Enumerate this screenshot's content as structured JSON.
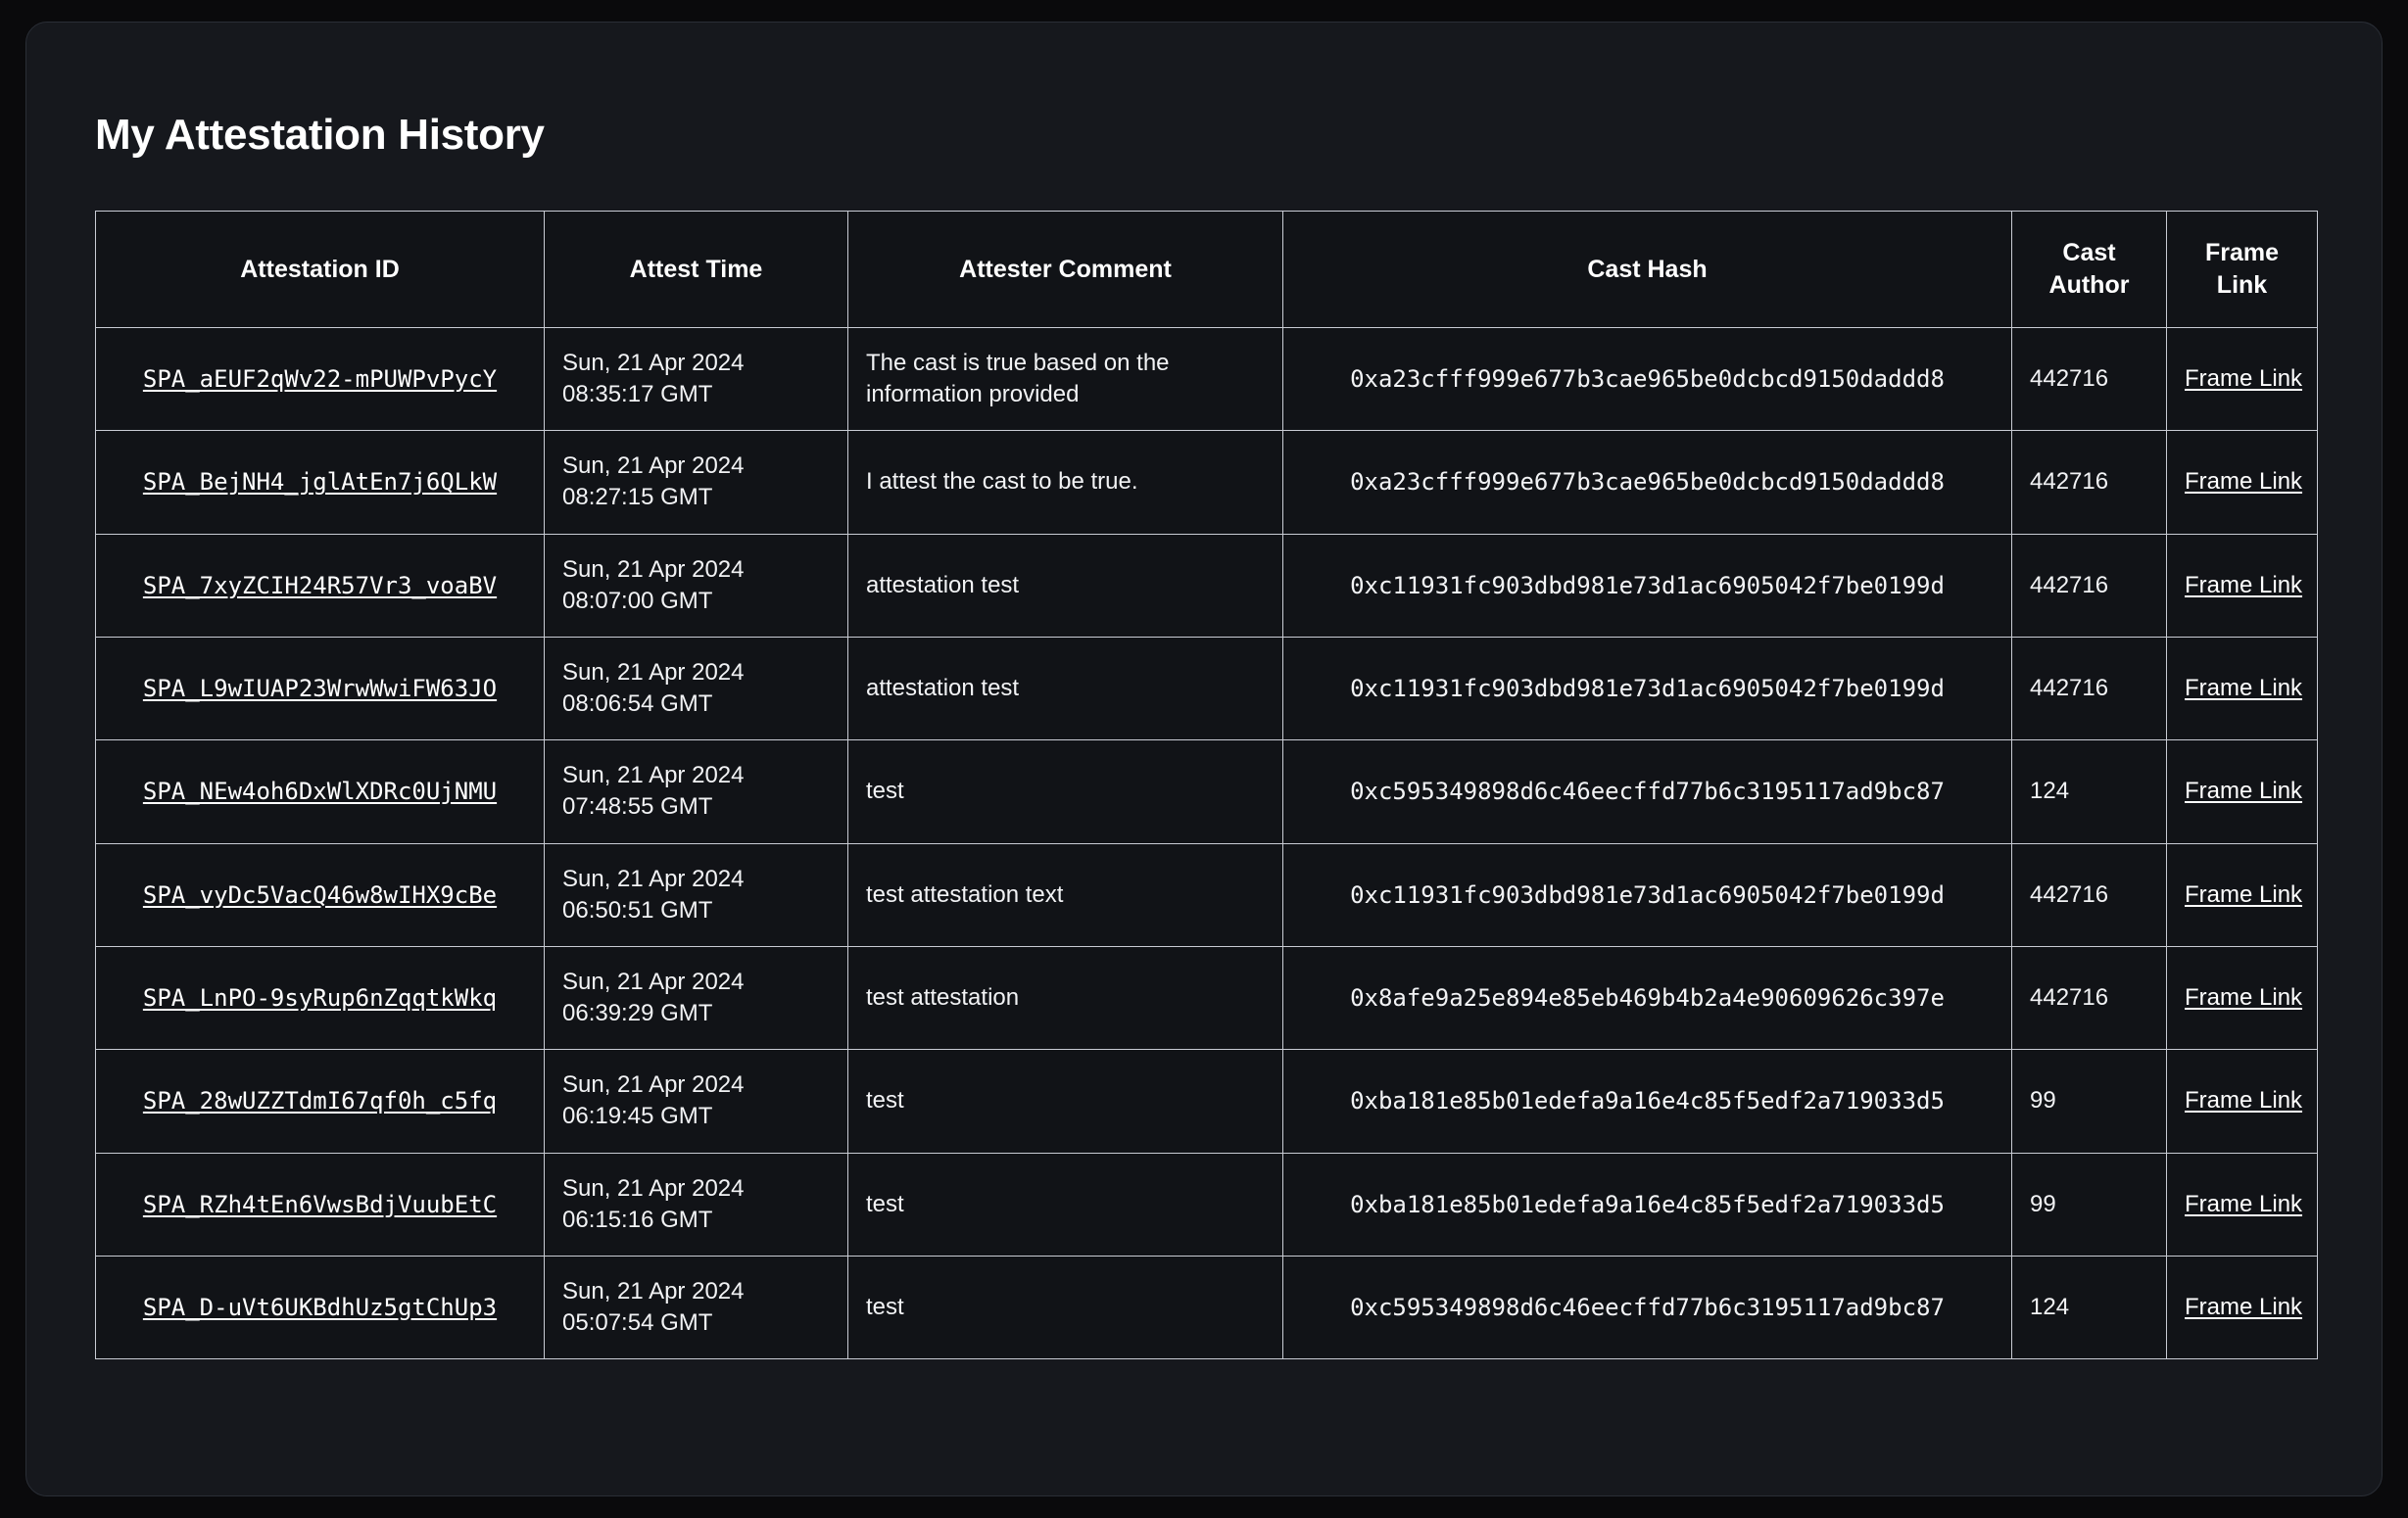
{
  "page": {
    "title": "My Attestation History"
  },
  "table": {
    "columns": [
      "Attestation ID",
      "Attest Time",
      "Attester Comment",
      "Cast Hash",
      "Cast Author",
      "Frame Link"
    ],
    "frame_link_label": "Frame Link",
    "rows": [
      {
        "attestation_id": "SPA_aEUF2qWv22-mPUWPvPycY",
        "attest_time": "Sun, 21 Apr 2024 08:35:17 GMT",
        "attester_comment": "The cast is true based on the information provided",
        "cast_hash": "0xa23cfff999e677b3cae965be0dcbcd9150daddd8",
        "cast_author": "442716",
        "frame_link": "Frame Link"
      },
      {
        "attestation_id": "SPA_BejNH4_jglAtEn7j6QLkW",
        "attest_time": "Sun, 21 Apr 2024 08:27:15 GMT",
        "attester_comment": "I attest the cast to be true.",
        "cast_hash": "0xa23cfff999e677b3cae965be0dcbcd9150daddd8",
        "cast_author": "442716",
        "frame_link": "Frame Link"
      },
      {
        "attestation_id": "SPA_7xyZCIH24R57Vr3_voaBV",
        "attest_time": "Sun, 21 Apr 2024 08:07:00 GMT",
        "attester_comment": "attestation test",
        "cast_hash": "0xc11931fc903dbd981e73d1ac6905042f7be0199d",
        "cast_author": "442716",
        "frame_link": "Frame Link"
      },
      {
        "attestation_id": "SPA_L9wIUAP23WrwWwiFW63JO",
        "attest_time": "Sun, 21 Apr 2024 08:06:54 GMT",
        "attester_comment": "attestation test",
        "cast_hash": "0xc11931fc903dbd981e73d1ac6905042f7be0199d",
        "cast_author": "442716",
        "frame_link": "Frame Link"
      },
      {
        "attestation_id": "SPA_NEw4oh6DxWlXDRc0UjNMU",
        "attest_time": "Sun, 21 Apr 2024 07:48:55 GMT",
        "attester_comment": "test",
        "cast_hash": "0xc595349898d6c46eecffd77b6c3195117ad9bc87",
        "cast_author": "124",
        "frame_link": "Frame Link"
      },
      {
        "attestation_id": "SPA_vyDc5VacQ46w8wIHX9cBe",
        "attest_time": "Sun, 21 Apr 2024 06:50:51 GMT",
        "attester_comment": "test attestation text",
        "cast_hash": "0xc11931fc903dbd981e73d1ac6905042f7be0199d",
        "cast_author": "442716",
        "frame_link": "Frame Link"
      },
      {
        "attestation_id": "SPA_LnPO-9syRup6nZqqtkWkq",
        "attest_time": "Sun, 21 Apr 2024 06:39:29 GMT",
        "attester_comment": "test attestation",
        "cast_hash": "0x8afe9a25e894e85eb469b4b2a4e90609626c397e",
        "cast_author": "442716",
        "frame_link": "Frame Link"
      },
      {
        "attestation_id": "SPA_28wUZZTdmI67qf0h_c5fq",
        "attest_time": "Sun, 21 Apr 2024 06:19:45 GMT",
        "attester_comment": "test",
        "cast_hash": "0xba181e85b01edefa9a16e4c85f5edf2a719033d5",
        "cast_author": "99",
        "frame_link": "Frame Link"
      },
      {
        "attestation_id": "SPA_RZh4tEn6VwsBdjVuubEtC",
        "attest_time": "Sun, 21 Apr 2024 06:15:16 GMT",
        "attester_comment": "test",
        "cast_hash": "0xba181e85b01edefa9a16e4c85f5edf2a719033d5",
        "cast_author": "99",
        "frame_link": "Frame Link"
      },
      {
        "attestation_id": "SPA_D-uVt6UKBdhUz5gtChUp3",
        "attest_time": "Sun, 21 Apr 2024 05:07:54 GMT",
        "attester_comment": "test",
        "cast_hash": "0xc595349898d6c46eecffd77b6c3195117ad9bc87",
        "cast_author": "124",
        "frame_link": "Frame Link"
      }
    ]
  },
  "colors": {
    "page_background": "#0a0a0c",
    "card_background": "#16181d",
    "table_background": "#111317",
    "border": "#c9ccd4",
    "text": "#ffffff"
  }
}
